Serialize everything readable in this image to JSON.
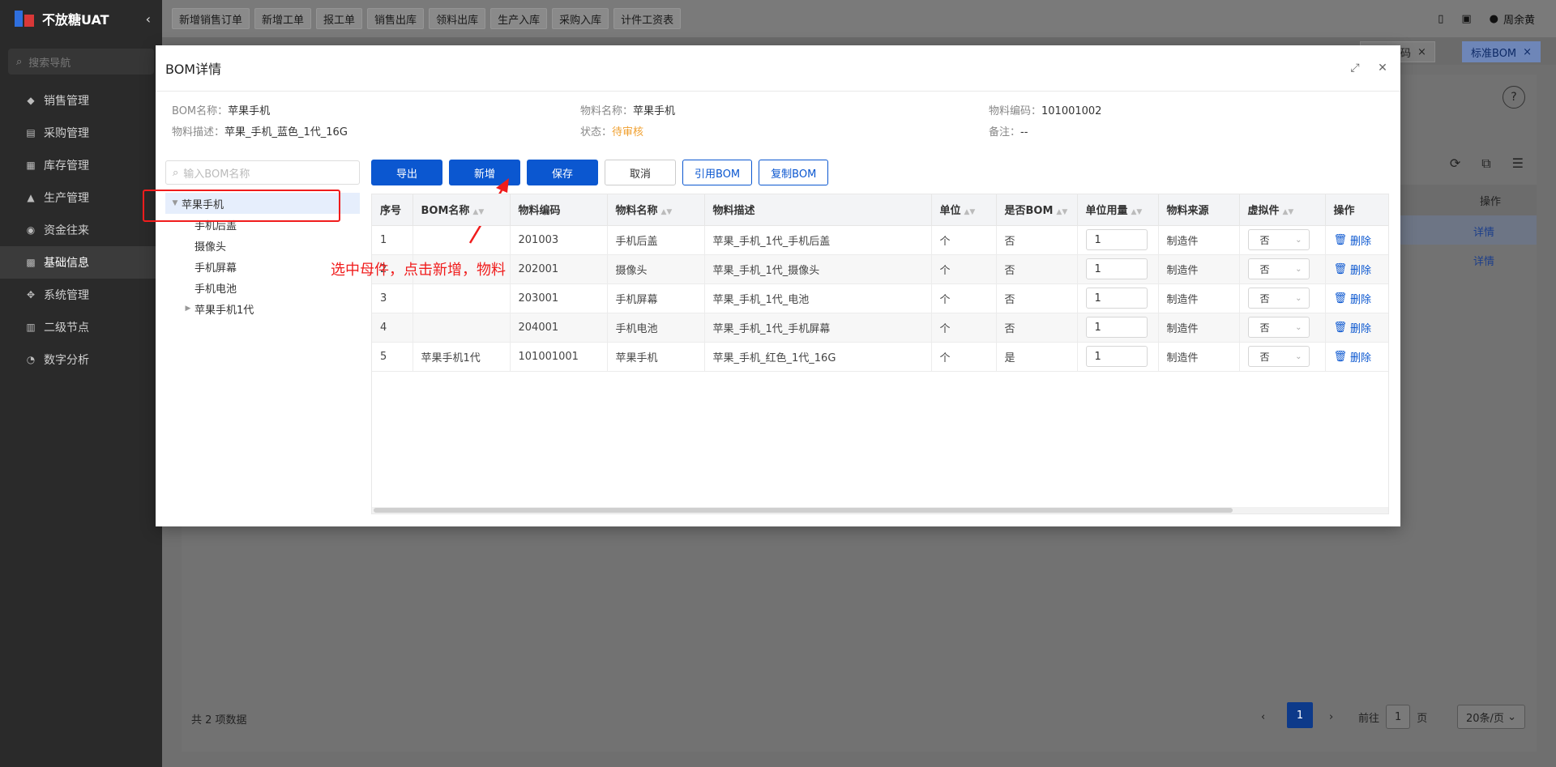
{
  "app": {
    "name": "不放糖UAT",
    "collapse_icon": "chevron-left-icon"
  },
  "sidebar": {
    "search_placeholder": "搜索导航",
    "items": [
      {
        "label": "销售管理",
        "icon": "tag-icon"
      },
      {
        "label": "采购管理",
        "icon": "cart-icon"
      },
      {
        "label": "库存管理",
        "icon": "inventory-icon"
      },
      {
        "label": "生产管理",
        "icon": "production-icon"
      },
      {
        "label": "资金往来",
        "icon": "money-icon"
      },
      {
        "label": "基础信息",
        "icon": "grid-icon",
        "active": true
      },
      {
        "label": "系统管理",
        "icon": "settings-icon"
      },
      {
        "label": "二级节点",
        "icon": "node-icon"
      },
      {
        "label": "数字分析",
        "icon": "pie-chart-icon"
      }
    ]
  },
  "topbar": {
    "quick": [
      "新增销售订单",
      "新增工单",
      "报工单",
      "销售出库",
      "领料出库",
      "生产入库",
      "采购入库",
      "计件工资表"
    ],
    "user": "周余黄"
  },
  "tabs": [
    {
      "label": "物料编码"
    },
    {
      "label": "标准BOM",
      "active": true
    }
  ],
  "background": {
    "col_op": "操作",
    "row_action": "详情",
    "total": "共 2 项数据",
    "page": "1",
    "goto_prefix": "前往",
    "goto_value": "1",
    "goto_suffix": "页",
    "page_size": "20条/页"
  },
  "modal": {
    "title": "BOM详情",
    "info": {
      "bom_name_label": "BOM名称：",
      "bom_name": "苹果手机",
      "material_name_label": "物料名称：",
      "material_name": "苹果手机",
      "material_code_label": "物料编码：",
      "material_code": "101001002",
      "desc_label": "物料描述：",
      "desc": "苹果_手机_蓝色_1代_16G",
      "status_label": "状态：",
      "status": "待审核",
      "status_color": "#f0a030",
      "remark_label": "备注：",
      "remark": "--"
    },
    "tree_search_placeholder": "输入BOM名称",
    "tree": [
      {
        "label": "苹果手机",
        "level": 0,
        "expanded": true,
        "selected": true
      },
      {
        "label": "手机后盖",
        "level": 1
      },
      {
        "label": "摄像头",
        "level": 1
      },
      {
        "label": "手机屏幕",
        "level": 1
      },
      {
        "label": "手机电池",
        "level": 1
      },
      {
        "label": "苹果手机1代",
        "level": 1,
        "collapsed": true
      }
    ],
    "buttons": {
      "export": "导出",
      "add": "新增",
      "save": "保存",
      "cancel": "取消",
      "ref_bom": "引用BOM",
      "copy_bom": "复制BOM"
    },
    "columns": [
      "序号",
      "BOM名称",
      "物料编码",
      "物料名称",
      "物料描述",
      "单位",
      "是否BOM",
      "单位用量",
      "物料来源",
      "虚拟件",
      "操作"
    ],
    "rows": [
      {
        "no": "1",
        "bom": "",
        "code": "201003",
        "name": "手机后盖",
        "desc": "苹果_手机_1代_手机后盖",
        "unit": "个",
        "is_bom": "否",
        "qty": "1",
        "source": "制造件",
        "virtual": "否",
        "action": "删除"
      },
      {
        "no": "2",
        "bom": "",
        "code": "202001",
        "name": "摄像头",
        "desc": "苹果_手机_1代_摄像头",
        "unit": "个",
        "is_bom": "否",
        "qty": "1",
        "source": "制造件",
        "virtual": "否",
        "action": "删除"
      },
      {
        "no": "3",
        "bom": "",
        "code": "203001",
        "name": "手机屏幕",
        "desc": "苹果_手机_1代_电池",
        "unit": "个",
        "is_bom": "否",
        "qty": "1",
        "source": "制造件",
        "virtual": "否",
        "action": "删除"
      },
      {
        "no": "4",
        "bom": "",
        "code": "204001",
        "name": "手机电池",
        "desc": "苹果_手机_1代_手机屏幕",
        "unit": "个",
        "is_bom": "否",
        "qty": "1",
        "source": "制造件",
        "virtual": "否",
        "action": "删除"
      },
      {
        "no": "5",
        "bom": "苹果手机1代",
        "code": "101001001",
        "name": "苹果手机",
        "desc": "苹果_手机_红色_1代_16G",
        "unit": "个",
        "is_bom": "是",
        "qty": "1",
        "source": "制造件",
        "virtual": "否",
        "action": "删除"
      }
    ],
    "annotation": "选中母件，点击新增，物料",
    "annotation_color": "#f01c1c"
  }
}
